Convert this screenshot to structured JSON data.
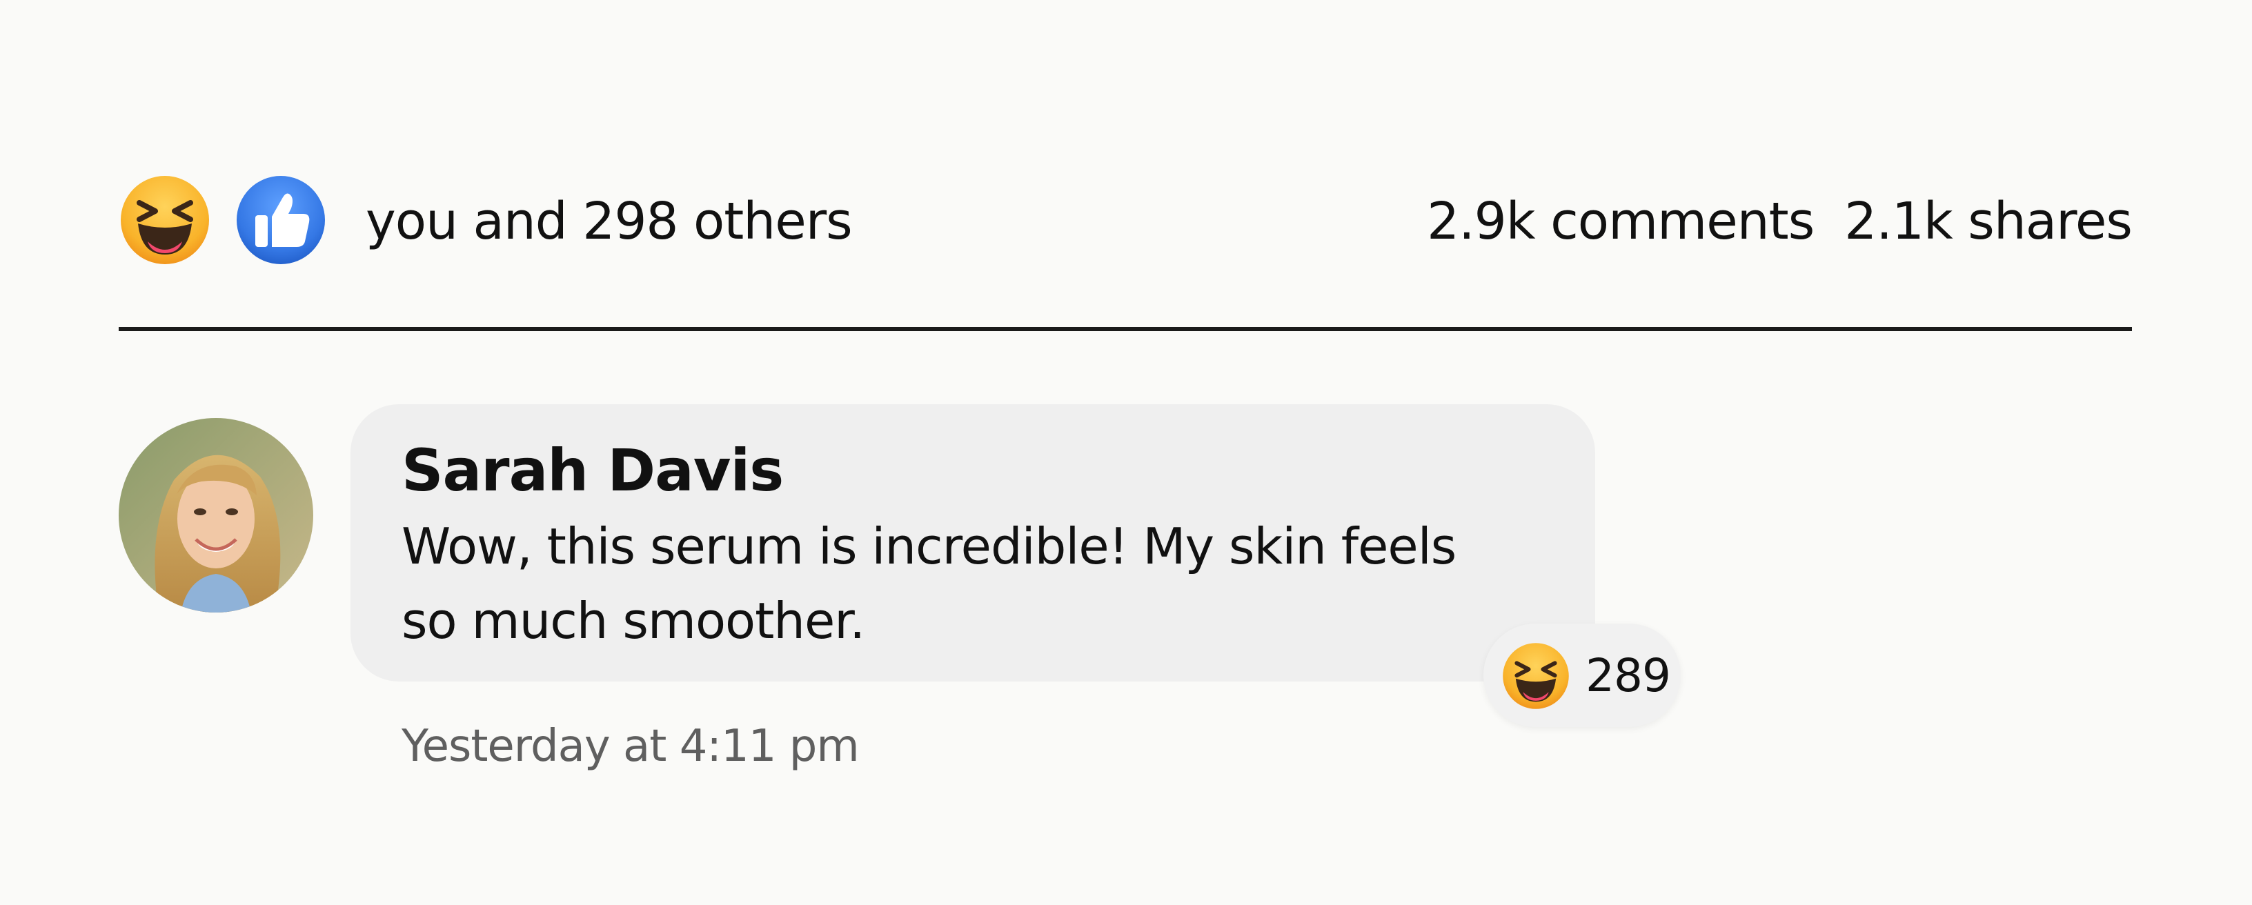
{
  "post_stats": {
    "reactions": [
      {
        "icon": "laughing-emoji-icon",
        "color": "#f7a21b"
      },
      {
        "icon": "thumbs-up-icon",
        "color": "#3578e5"
      }
    ],
    "reaction_summary": "you and 298 others",
    "comments_count": "2.9k comments",
    "shares_count": "2.1k shares"
  },
  "comment": {
    "author": "Sarah Davis",
    "text": "Wow, this serum is incredible! My skin feels so much smoother.",
    "timestamp": "Yesterday at 4:11 pm",
    "reaction": {
      "icon": "laughing-emoji-icon",
      "count": "289"
    }
  },
  "colors": {
    "background": "#fafaf8",
    "bubble": "#efefef",
    "text": "#111111",
    "muted_text": "#5f5f5f",
    "like_blue": "#3578e5",
    "emoji_yellow": "#f7a21b"
  }
}
